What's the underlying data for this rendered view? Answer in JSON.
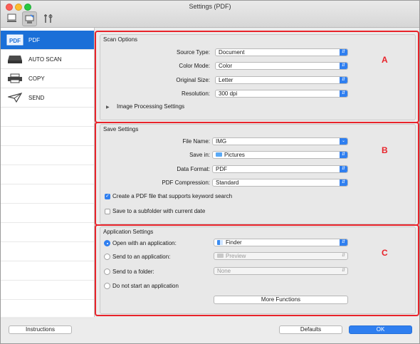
{
  "window": {
    "title": "Settings (PDF)"
  },
  "toolbar": {
    "tabs": [
      "scan-from-computer",
      "scan-from-operation-panel",
      "general-settings"
    ]
  },
  "sidebar": {
    "items": [
      {
        "label": "PDF",
        "icon": "pdf-icon",
        "selected": true
      },
      {
        "label": "AUTO SCAN",
        "icon": "scanner-icon",
        "selected": false
      },
      {
        "label": "COPY",
        "icon": "printer-icon",
        "selected": false
      },
      {
        "label": "SEND",
        "icon": "paper-plane-icon",
        "selected": false
      }
    ]
  },
  "scan_options": {
    "title": "Scan Options",
    "marker": "A",
    "source_type": {
      "label": "Source Type:",
      "value": "Document"
    },
    "color_mode": {
      "label": "Color Mode:",
      "value": "Color"
    },
    "original_size": {
      "label": "Original Size:",
      "value": "Letter"
    },
    "resolution": {
      "label": "Resolution:",
      "value": "300 dpi"
    },
    "image_processing": "Image Processing Settings"
  },
  "save_settings": {
    "title": "Save Settings",
    "marker": "B",
    "file_name": {
      "label": "File Name:",
      "value": "IMG"
    },
    "save_in": {
      "label": "Save in:",
      "value": "Pictures"
    },
    "data_format": {
      "label": "Data Format:",
      "value": "PDF"
    },
    "pdf_compression": {
      "label": "PDF Compression:",
      "value": "Standard"
    },
    "keyword_search": {
      "label": "Create a PDF file that supports keyword search",
      "checked": true
    },
    "subfolder": {
      "label": "Save to a subfolder with current date",
      "checked": false
    }
  },
  "application_settings": {
    "title": "Application Settings",
    "marker": "C",
    "open_with": {
      "label": "Open with an application:",
      "value": "Finder",
      "selected": true
    },
    "send_to_app": {
      "label": "Send to an application:",
      "value": "Preview",
      "selected": false
    },
    "send_to_folder": {
      "label": "Send to a folder:",
      "value": "None",
      "selected": false
    },
    "no_app": {
      "label": "Do not start an application",
      "selected": false
    },
    "more_functions": "More Functions"
  },
  "footer": {
    "instructions": "Instructions",
    "defaults": "Defaults",
    "ok": "OK"
  },
  "colors": {
    "accent": "#2f7ff0",
    "annotation": "#e8232a",
    "selection": "#1a6fd8"
  }
}
